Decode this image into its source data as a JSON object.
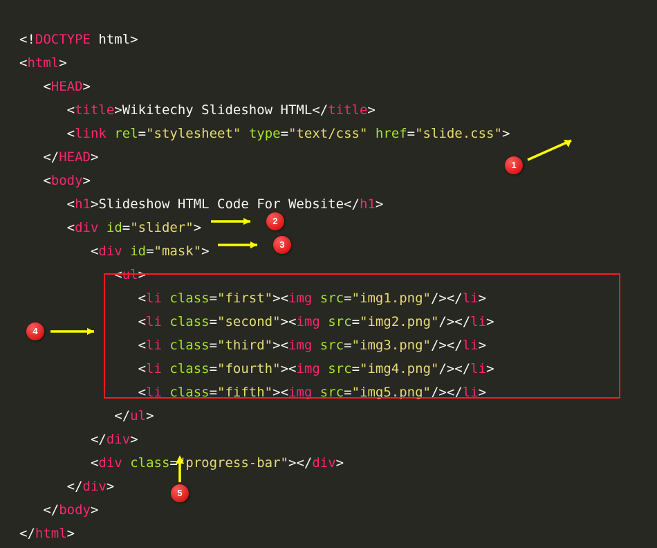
{
  "code": {
    "doctype_open": "<!",
    "doctype_tag": "DOCTYPE",
    "doctype_rest": " html",
    "html_tag": "html",
    "head_tag": "HEAD",
    "title_tag": "title",
    "title_text": "Wikitechy Slideshow HTML",
    "link_tag": "link",
    "attr_rel": "rel",
    "val_rel": "\"stylesheet\"",
    "attr_type": "type",
    "val_type": "\"text/css\"",
    "attr_href": "href",
    "val_href": "\"slide.css\"",
    "body_tag": "body",
    "h1_tag": "h1",
    "h1_text": "Slideshow HTML Code For Website",
    "div_tag": "div",
    "attr_id": "id",
    "val_slider": "\"slider\"",
    "val_mask": "\"mask\"",
    "ul_tag": "ul",
    "li_tag": "li",
    "attr_class": "class",
    "li1_class": "\"first\"",
    "li2_class": "\"second\"",
    "li3_class": "\"third\"",
    "li4_class": "\"fourth\"",
    "li5_class": "\"fifth\"",
    "img_tag": "img",
    "attr_src": "src",
    "img1_src": "\"img1.png\"",
    "img2_src": "\"img2.png\"",
    "img3_src": "\"img3.png\"",
    "img4_src": "\"img4.png\"",
    "img5_src": "\"img5.png\"",
    "val_progress": "\"progress-bar\""
  },
  "badges": {
    "b1": "1",
    "b2": "2",
    "b3": "3",
    "b4": "4",
    "b5": "5"
  }
}
